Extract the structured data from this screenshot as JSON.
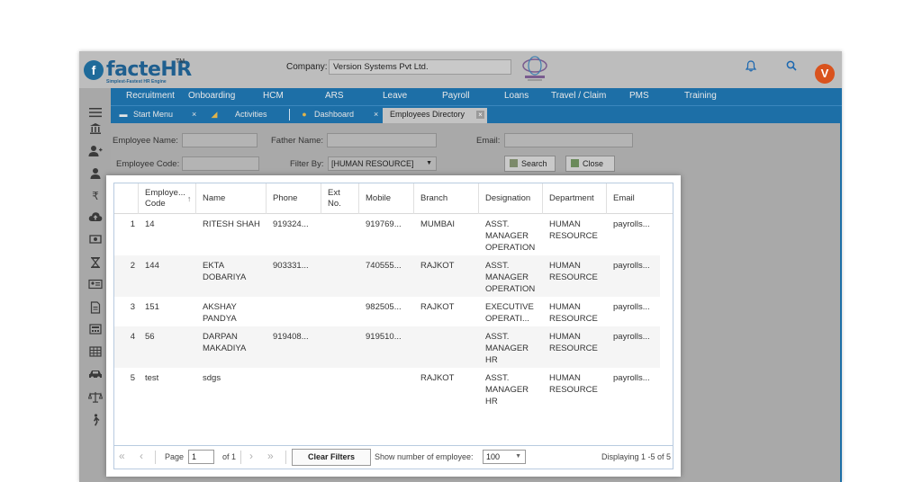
{
  "brand": {
    "name": "facteHR",
    "tm": "TM",
    "tagline": "Simplest-Fastest HR Engine",
    "logo_mark": "f"
  },
  "header": {
    "company_label": "Company:",
    "company_value": "Version Systems Pvt Ltd.",
    "avatar_initial": "V",
    "icons": [
      "bell-icon",
      "search-icon"
    ]
  },
  "nav": {
    "items": [
      "Recruitment",
      "Onboarding",
      "HCM",
      "ARS",
      "Leave",
      "Payroll",
      "Loans",
      "Travel / Claim",
      "PMS",
      "Training"
    ]
  },
  "tabs": {
    "start_menu": "Start Menu",
    "activities": "Activities",
    "dashboard": "Dashboard",
    "employees_directory": "Employees Directory",
    "close_glyph": "×"
  },
  "filters": {
    "employee_name_label": "Employee Name:",
    "father_name_label": "Father Name:",
    "email_label": "Email:",
    "employee_code_label": "Employee Code:",
    "filter_by_label": "Filter By:",
    "filter_by_value": "[HUMAN RESOURCE]",
    "search_button": "Search",
    "close_button": "Close"
  },
  "grid": {
    "columns": [
      "Employe... Code",
      "Name",
      "Phone",
      "Ext No.",
      "Mobile",
      "Branch",
      "Designation",
      "Department",
      "Email"
    ],
    "col_employee_code_line1": "Employe...",
    "col_employee_code_line2": "Code",
    "col_ext_line1": "Ext",
    "col_ext_line2": "No.",
    "rows": [
      {
        "num": "1",
        "code": "14",
        "name": "RITESH SHAH",
        "phone": "919324...",
        "ext": "",
        "mobile": "919769...",
        "branch": "MUMBAI",
        "designation": "ASST. MANAGER OPERATION",
        "department": "HUMAN RESOURCE",
        "email": "payrolls..."
      },
      {
        "num": "2",
        "code": "144",
        "name": "EKTA DOBARIYA",
        "phone": "903331...",
        "ext": "",
        "mobile": "740555...",
        "branch": "RAJKOT",
        "designation": "ASST. MANAGER OPERATION",
        "department": "HUMAN RESOURCE",
        "email": "payrolls..."
      },
      {
        "num": "3",
        "code": "151",
        "name": "AKSHAY PANDYA",
        "phone": "",
        "ext": "",
        "mobile": "982505...",
        "branch": "RAJKOT",
        "designation": "EXECUTIVE OPERATI...",
        "department": "HUMAN RESOURCE",
        "email": "payrolls..."
      },
      {
        "num": "4",
        "code": "56",
        "name": "DARPAN MAKADIYA",
        "phone": "919408...",
        "ext": "",
        "mobile": "919510...",
        "branch": "",
        "designation": "ASST. MANAGER HR",
        "department": "HUMAN RESOURCE",
        "email": "payrolls..."
      },
      {
        "num": "5",
        "code": "test",
        "name": "sdgs",
        "phone": "",
        "ext": "",
        "mobile": "",
        "branch": "RAJKOT",
        "designation": "ASST. MANAGER HR",
        "department": "HUMAN RESOURCE",
        "email": "payrolls..."
      }
    ]
  },
  "pager": {
    "page_label": "Page",
    "page_value": "1",
    "of_label": "of 1",
    "clear_filters": "Clear Filters",
    "show_number_label": "Show number of employee:",
    "page_size": "100",
    "displaying": "Displaying 1 -5 of 5"
  },
  "colors": {
    "nav_blue": "#1d6fa7",
    "avatar": "#d9531e",
    "brand_blue": "#1f5f8f"
  }
}
